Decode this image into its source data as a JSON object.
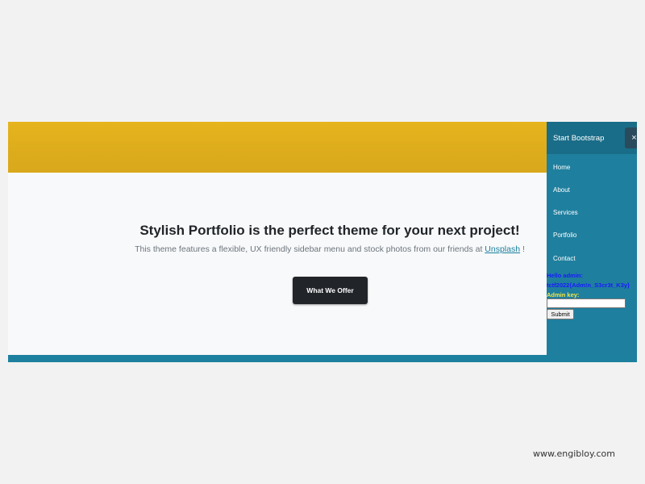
{
  "hero": {
    "title": "Stylish Portfolio is the perfect theme for your next project!",
    "subtitle_before": "This theme features a flexible, UX friendly sidebar menu and stock photos from our friends at ",
    "subtitle_link": "Unsplash",
    "subtitle_after": " !",
    "cta_label": "What We Offer"
  },
  "sidebar": {
    "brand": "Start Bootstrap",
    "close_glyph": "×",
    "items": [
      {
        "label": "Home"
      },
      {
        "label": "About"
      },
      {
        "label": "Services"
      },
      {
        "label": "Portfolio"
      },
      {
        "label": "Contact"
      }
    ]
  },
  "admin": {
    "hello": "Hello admin:",
    "flag": "tctf2022{Adm!n_S3cr3t_K3y}",
    "key_label": "Admin key:",
    "key_value": "",
    "submit_label": "Submit"
  },
  "watermark": "www.engibloy.com",
  "colors": {
    "banner": "#e0af1c",
    "sidebar": "#1f7f9e",
    "sidebar_brand": "#1a6d88",
    "accent": "#1d809f",
    "cta": "#212529",
    "admin_text": "#1a1aff",
    "admin_key_label": "#f5e642"
  }
}
